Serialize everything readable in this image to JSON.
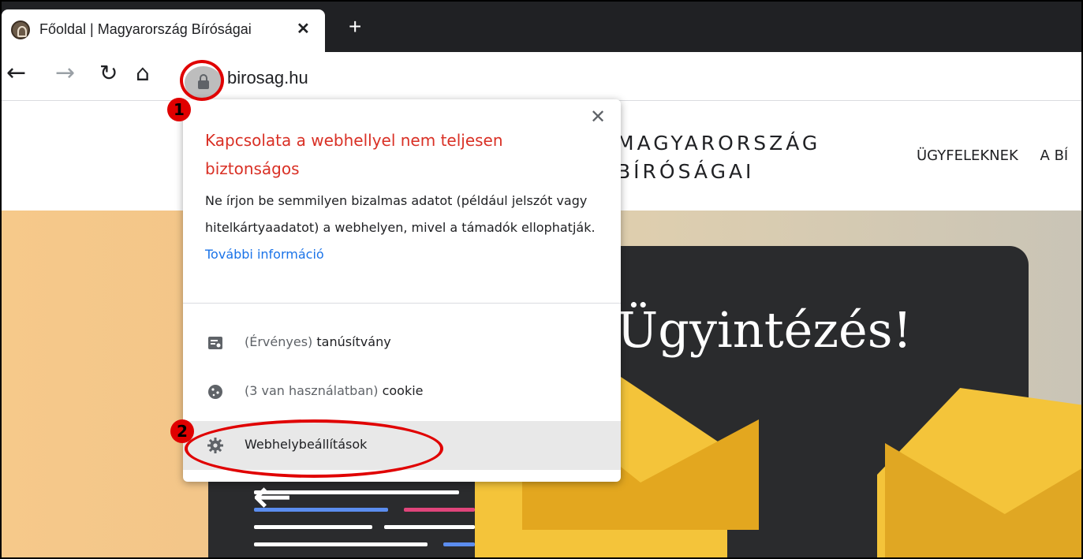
{
  "browser": {
    "tab_title": "Főoldal | Magyarország Bíróságai",
    "tab_close": "✕",
    "new_tab": "+",
    "url": "birosag.hu"
  },
  "page": {
    "brand_line1": "MAGYARORSZÁG",
    "brand_line2": "BÍRÓSÁGAI",
    "nav": [
      "ÜGYFELEKNEK",
      "A BÍ"
    ],
    "hero_text": "Ügyintézés!"
  },
  "popup": {
    "close": "✕",
    "title": "Kapcsolata a webhellyel nem teljesen biztonságos",
    "body": "Ne írjon be semmilyen bizalmas adatot (például jelszót vagy hitelkártyaadatot) a webhelyen, mivel a támadók ellophatják.",
    "link": "További információ",
    "items": [
      {
        "muted": "(Érvényes)",
        "label": "tanúsítvány",
        "icon": "certificate-icon"
      },
      {
        "muted": "(3 van használatban)",
        "label": "cookie",
        "icon": "cookie-icon"
      },
      {
        "muted": "",
        "label": "Webhelybeállítások",
        "icon": "gear-icon"
      }
    ]
  },
  "annotations": {
    "badge1": "1",
    "badge2": "2",
    "color": "#e00000"
  }
}
